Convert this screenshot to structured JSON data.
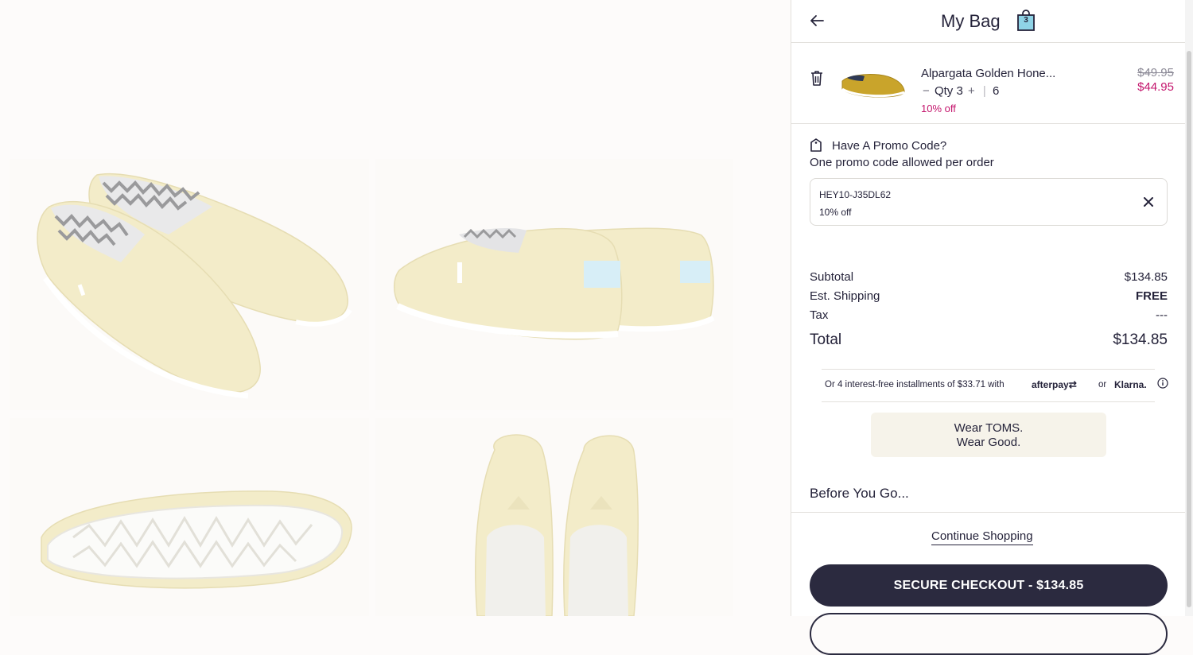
{
  "bag": {
    "title": "My Bag",
    "count": "3"
  },
  "item": {
    "name": "Alpargata Golden Hone...",
    "qty_minus": "−",
    "qty_label": "Qty 3",
    "qty_plus": "+",
    "qty_sep": "|",
    "size": "6",
    "discount": "10% off",
    "price_original": "$49.95",
    "price_sale": "$44.95"
  },
  "promo": {
    "title": "Have A Promo Code?",
    "subtitle": "One promo code allowed per order",
    "code": "HEY10-J35DL62",
    "code_discount": "10% off"
  },
  "summary": {
    "subtotal_label": "Subtotal",
    "subtotal_value": "$134.85",
    "shipping_label": "Est. Shipping",
    "shipping_value": "FREE",
    "tax_label": "Tax",
    "tax_value": "---",
    "total_label": "Total",
    "total_value": "$134.85"
  },
  "installments": {
    "text": "Or 4 interest-free installments of $33.71 with",
    "afterpay": "afterpay⇄",
    "or": "or",
    "klarna": "Klarna."
  },
  "slogan": {
    "line1": "Wear TOMS.",
    "line2": "Wear Good."
  },
  "before_you_go": "Before You Go...",
  "continue_shopping": "Continue Shopping",
  "checkout_button": "SECURE CHECKOUT - $134.85",
  "colors": {
    "accent_dark": "#2b2a3f",
    "sale_pink": "#c4166d",
    "shoe_cream": "#f3ecc9",
    "shoe_golden": "#c9a42b"
  },
  "icons": [
    "back-arrow-icon",
    "shopping-bag-icon",
    "trash-icon",
    "price-tag-icon",
    "close-icon",
    "info-icon"
  ]
}
